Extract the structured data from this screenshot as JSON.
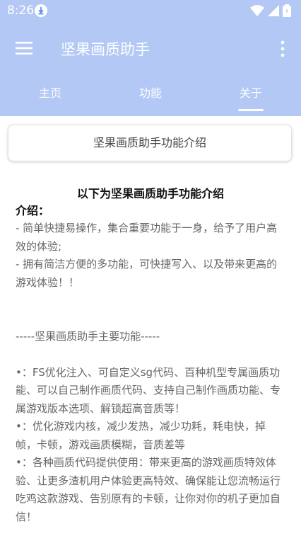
{
  "status": {
    "time": "8:26"
  },
  "header": {
    "title": "坚果画质助手"
  },
  "tabs": [
    {
      "label": "主页"
    },
    {
      "label": "功能"
    },
    {
      "label": "关于"
    }
  ],
  "card": {
    "title": "坚果画质助手功能介绍"
  },
  "content": {
    "heading": "以下为坚果画质助手功能介绍",
    "intro_label": "介绍：",
    "intro_lines": [
      "- 简单快捷易操作，集合重要功能于一身，给予了用户高效的体验;",
      "- 拥有简洁方便的多功能，可快捷写入、以及带来更高的游戏体验！！"
    ],
    "section_title": "-----坚果画质助手主要功能-----",
    "features": [
      "•：FS优化注入、可自定义sg代码、百种机型专属画质功能、可以自己制作画质代码、支持自己制作画质功能、专属游戏版本选项、解锁超高音质等！",
      "•：优化游戏内核，减少发热，减少功耗，耗电快，掉帧，卡顿，游戏画质模糊，音质差等",
      "•：各种画质代码提供使用：带来更高的游戏画质特效体验、让更多渣机用户体验更高特效、确保能让您流畅运行吃鸡这款游戏、告别原有的卡顿，让你对你的机子更加自信！"
    ]
  },
  "colors": {
    "appbar": "#b3c8f4"
  }
}
